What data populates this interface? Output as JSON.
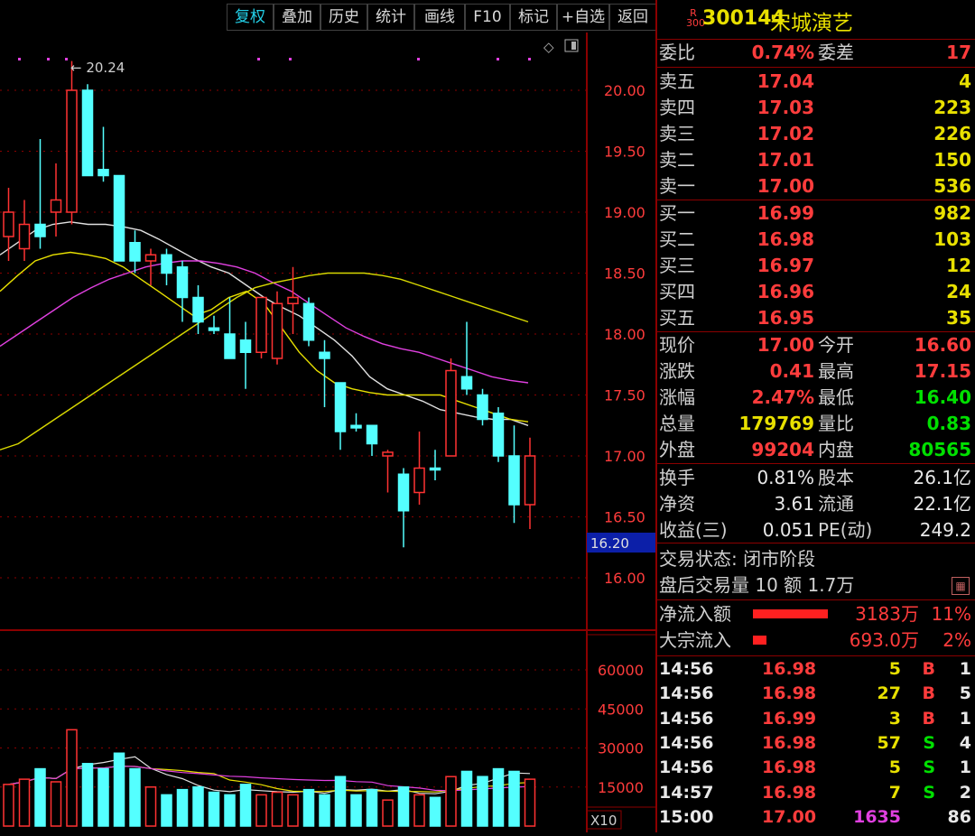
{
  "toolbar": {
    "buttons": [
      "复权",
      "叠加",
      "历史",
      "统计",
      "画线",
      "F10",
      "标记",
      "+自选",
      "返回"
    ]
  },
  "chart_data": {
    "type": "candlestick",
    "price_axis_ticks": [
      "20.00",
      "19.50",
      "19.00",
      "18.50",
      "18.00",
      "17.50",
      "17.00",
      "16.50",
      "16.00"
    ],
    "current_price_tag": "16.20",
    "high_marker": "20.24",
    "volume_axis_ticks": [
      "60000",
      "45000",
      "30000",
      "15000"
    ],
    "volume_unit": "X10",
    "candles": [
      {
        "o": 18.8,
        "c": 19.0,
        "h": 19.2,
        "l": 18.6,
        "v": 16000
      },
      {
        "o": 18.7,
        "c": 18.9,
        "h": 19.1,
        "l": 18.6,
        "v": 18000
      },
      {
        "o": 18.9,
        "c": 18.8,
        "h": 19.6,
        "l": 18.7,
        "v": 22000
      },
      {
        "o": 19.0,
        "c": 19.1,
        "h": 19.4,
        "l": 18.8,
        "v": 17000
      },
      {
        "o": 19.0,
        "c": 20.0,
        "h": 20.24,
        "l": 18.9,
        "v": 37000
      },
      {
        "o": 20.0,
        "c": 19.3,
        "h": 20.05,
        "l": 19.3,
        "v": 24000
      },
      {
        "o": 19.35,
        "c": 19.3,
        "h": 19.7,
        "l": 19.25,
        "v": 22000
      },
      {
        "o": 19.3,
        "c": 18.6,
        "h": 19.3,
        "l": 18.6,
        "v": 28000
      },
      {
        "o": 18.75,
        "c": 18.6,
        "h": 18.85,
        "l": 18.5,
        "v": 22000
      },
      {
        "o": 18.6,
        "c": 18.65,
        "h": 18.7,
        "l": 18.4,
        "v": 15000
      },
      {
        "o": 18.65,
        "c": 18.5,
        "h": 18.7,
        "l": 18.4,
        "v": 12000
      },
      {
        "o": 18.55,
        "c": 18.3,
        "h": 18.6,
        "l": 18.1,
        "v": 14000
      },
      {
        "o": 18.3,
        "c": 18.1,
        "h": 18.4,
        "l": 18.0,
        "v": 15000
      },
      {
        "o": 18.05,
        "c": 18.03,
        "h": 18.15,
        "l": 18.0,
        "v": 13000
      },
      {
        "o": 18.0,
        "c": 17.8,
        "h": 18.3,
        "l": 17.8,
        "v": 12000
      },
      {
        "o": 17.95,
        "c": 17.85,
        "h": 18.1,
        "l": 17.55,
        "v": 16000
      },
      {
        "o": 17.85,
        "c": 18.3,
        "h": 18.3,
        "l": 17.8,
        "v": 12000
      },
      {
        "o": 17.8,
        "c": 18.25,
        "h": 18.35,
        "l": 17.75,
        "v": 13000
      },
      {
        "o": 18.25,
        "c": 18.3,
        "h": 18.55,
        "l": 18.0,
        "v": 12000
      },
      {
        "o": 18.25,
        "c": 17.95,
        "h": 18.3,
        "l": 17.9,
        "v": 14000
      },
      {
        "o": 17.85,
        "c": 17.8,
        "h": 17.95,
        "l": 17.4,
        "v": 12000
      },
      {
        "o": 17.6,
        "c": 17.2,
        "h": 17.6,
        "l": 17.05,
        "v": 19000
      },
      {
        "o": 17.25,
        "c": 17.23,
        "h": 17.35,
        "l": 17.2,
        "v": 12000
      },
      {
        "o": 17.25,
        "c": 17.1,
        "h": 17.25,
        "l": 17.0,
        "v": 14000
      },
      {
        "o": 17.0,
        "c": 17.03,
        "h": 17.05,
        "l": 16.7,
        "v": 10000
      },
      {
        "o": 16.85,
        "c": 16.55,
        "h": 16.9,
        "l": 16.25,
        "v": 15000
      },
      {
        "o": 16.7,
        "c": 16.9,
        "h": 17.2,
        "l": 16.6,
        "v": 12000
      },
      {
        "o": 16.9,
        "c": 16.9,
        "h": 17.05,
        "l": 16.8,
        "v": 11000
      },
      {
        "o": 17.0,
        "c": 17.7,
        "h": 17.8,
        "l": 17.0,
        "v": 19000
      },
      {
        "o": 17.65,
        "c": 17.55,
        "h": 18.1,
        "l": 17.5,
        "v": 21000
      },
      {
        "o": 17.5,
        "c": 17.3,
        "h": 17.55,
        "l": 17.25,
        "v": 19000
      },
      {
        "o": 17.35,
        "c": 17.0,
        "h": 17.4,
        "l": 16.95,
        "v": 22000
      },
      {
        "o": 17.0,
        "c": 16.6,
        "h": 17.25,
        "l": 16.45,
        "v": 21000
      },
      {
        "o": 16.6,
        "c": 17.0,
        "h": 17.15,
        "l": 16.4,
        "v": 18000
      }
    ],
    "ma": {
      "white": [
        18.65,
        18.75,
        18.85,
        18.9,
        18.92,
        18.9,
        18.9,
        18.88,
        18.85,
        18.78,
        18.7,
        18.62,
        18.55,
        18.5,
        18.4,
        18.3,
        18.22,
        18.15,
        18.05,
        17.95,
        17.82,
        17.65,
        17.55,
        17.5,
        17.45,
        17.38,
        17.35,
        17.32,
        17.3,
        17.3,
        17.25
      ],
      "yellow": [
        18.35,
        18.48,
        18.6,
        18.65,
        18.67,
        18.65,
        18.62,
        18.55,
        18.45,
        18.35,
        18.25,
        18.15,
        18.2,
        18.3,
        18.35,
        18.25,
        18.05,
        17.85,
        17.7,
        17.6,
        17.55,
        17.52,
        17.5,
        17.5,
        17.5,
        17.5,
        17.45,
        17.4,
        17.35,
        17.3,
        17.28
      ],
      "magenta": [
        17.9,
        18.0,
        18.1,
        18.2,
        18.3,
        18.38,
        18.45,
        18.5,
        18.55,
        18.58,
        18.6,
        18.6,
        18.58,
        18.55,
        18.5,
        18.42,
        18.35,
        18.25,
        18.15,
        18.05,
        17.98,
        17.92,
        17.88,
        17.85,
        17.8,
        17.75,
        17.7,
        17.65,
        17.62,
        17.6
      ],
      "olive": [
        17.05,
        17.1,
        17.2,
        17.3,
        17.4,
        17.5,
        17.6,
        17.7,
        17.8,
        17.9,
        18.0,
        18.1,
        18.2,
        18.3,
        18.38,
        18.42,
        18.45,
        18.48,
        18.5,
        18.5,
        18.5,
        18.48,
        18.45,
        18.4,
        18.35,
        18.3,
        18.25,
        18.2,
        18.15,
        18.1
      ]
    }
  },
  "quote": {
    "code_prefix_top": "R",
    "code_prefix_bottom": "300",
    "code": "300144",
    "name": "宋城演艺",
    "wei_bi_label": "委比",
    "wei_bi": "0.74%",
    "wei_cha_label": "委差",
    "wei_cha": "17",
    "sell": [
      {
        "label": "卖五",
        "price": "17.04",
        "vol": "4"
      },
      {
        "label": "卖四",
        "price": "17.03",
        "vol": "223"
      },
      {
        "label": "卖三",
        "price": "17.02",
        "vol": "226"
      },
      {
        "label": "卖二",
        "price": "17.01",
        "vol": "150"
      },
      {
        "label": "卖一",
        "price": "17.00",
        "vol": "536"
      }
    ],
    "buy": [
      {
        "label": "买一",
        "price": "16.99",
        "vol": "982"
      },
      {
        "label": "买二",
        "price": "16.98",
        "vol": "103"
      },
      {
        "label": "买三",
        "price": "16.97",
        "vol": "12"
      },
      {
        "label": "买四",
        "price": "16.96",
        "vol": "24"
      },
      {
        "label": "买五",
        "price": "16.95",
        "vol": "35"
      }
    ],
    "stats": [
      {
        "l1": "现价",
        "v1": "17.00",
        "c1": "red",
        "l2": "今开",
        "v2": "16.60",
        "c2": "red"
      },
      {
        "l1": "涨跌",
        "v1": "0.41",
        "c1": "red",
        "l2": "最高",
        "v2": "17.15",
        "c2": "red"
      },
      {
        "l1": "涨幅",
        "v1": "2.47%",
        "c1": "red",
        "l2": "最低",
        "v2": "16.40",
        "c2": "green"
      },
      {
        "l1": "总量",
        "v1": "179769",
        "c1": "yellow",
        "l2": "量比",
        "v2": "0.83",
        "c2": "green"
      },
      {
        "l1": "外盘",
        "v1": "99204",
        "c1": "red",
        "l2": "内盘",
        "v2": "80565",
        "c2": "green"
      }
    ],
    "fundamentals": [
      {
        "l1": "换手",
        "v1": "0.81%",
        "l2": "股本",
        "v2": "26.1亿"
      },
      {
        "l1": "净资",
        "v1": "3.61",
        "l2": "流通",
        "v2": "22.1亿"
      },
      {
        "l1": "收益(三)",
        "v1": "0.051",
        "l2": "PE(动)",
        "v2": "249.2"
      }
    ],
    "trade_status": "交易状态: 闭市阶段",
    "after_hours": "盘后交易量 10 额 1.7万",
    "net_inflow_label": "净流入额",
    "net_inflow_value": "3183万",
    "net_inflow_pct": "11%",
    "net_inflow_bar": 0.55,
    "block_inflow_label": "大宗流入",
    "block_inflow_value": "693.0万",
    "block_inflow_pct": "2%",
    "block_inflow_bar": 0.1,
    "ticks": [
      {
        "time": "14:56",
        "price": "16.98",
        "vol": "5",
        "bs": "B",
        "n": "1"
      },
      {
        "time": "14:56",
        "price": "16.98",
        "vol": "27",
        "bs": "B",
        "n": "5"
      },
      {
        "time": "14:56",
        "price": "16.99",
        "vol": "3",
        "bs": "B",
        "n": "1"
      },
      {
        "time": "14:56",
        "price": "16.98",
        "vol": "57",
        "bs": "S",
        "n": "4"
      },
      {
        "time": "14:56",
        "price": "16.98",
        "vol": "5",
        "bs": "S",
        "n": "1"
      },
      {
        "time": "14:57",
        "price": "16.98",
        "vol": "7",
        "bs": "S",
        "n": "2"
      },
      {
        "time": "15:00",
        "price": "17.00",
        "vol": "1635",
        "bs": "",
        "n": "86"
      }
    ]
  }
}
